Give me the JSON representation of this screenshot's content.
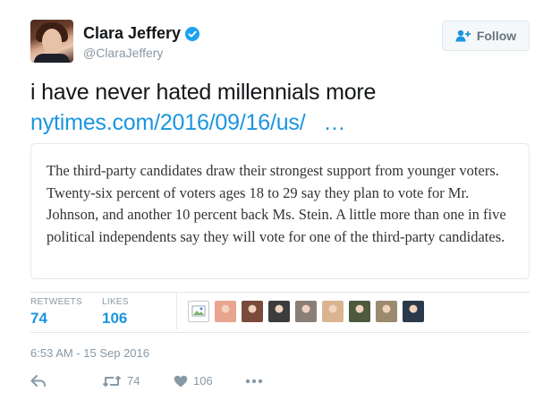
{
  "user": {
    "name": "Clara Jeffery",
    "handle": "@ClaraJeffery"
  },
  "follow_button": {
    "label": "Follow"
  },
  "tweet": {
    "text": "i have never hated millennials more",
    "link_text": "nytimes.com/2016/09/16/us/",
    "ellipsis": "…"
  },
  "quote": {
    "text": "The third-party candidates draw their strongest support from younger voters. Twenty-six percent of voters ages 18 to 29 say they plan to vote for Mr. Johnson, and another 10 percent back Ms. Stein. A little more than one in five political independents say they will vote for one of the third-party candidates."
  },
  "stats": {
    "retweets_label": "RETWEETS",
    "retweets_value": "74",
    "likes_label": "LIKES",
    "likes_value": "106"
  },
  "liker_avatars": [
    {
      "icon": "broken-image-icon",
      "color": "#ffffff"
    },
    {
      "icon": "avatar",
      "color": "#e9a48f"
    },
    {
      "icon": "avatar",
      "color": "#7a4a3a"
    },
    {
      "icon": "avatar",
      "color": "#3c3c3c"
    },
    {
      "icon": "avatar",
      "color": "#8a7f77"
    },
    {
      "icon": "avatar",
      "color": "#d9b48f"
    },
    {
      "icon": "avatar",
      "color": "#4d5a3c"
    },
    {
      "icon": "avatar",
      "color": "#9c8a6f"
    },
    {
      "icon": "avatar",
      "color": "#2a3a4a"
    }
  ],
  "timestamp": "6:53 AM - 15 Sep 2016",
  "actions": {
    "retweet_count": "74",
    "like_count": "106"
  },
  "colors": {
    "link": "#1b95e0",
    "muted": "#8899a6",
    "border": "#e1e8ed",
    "text": "#14171a"
  }
}
